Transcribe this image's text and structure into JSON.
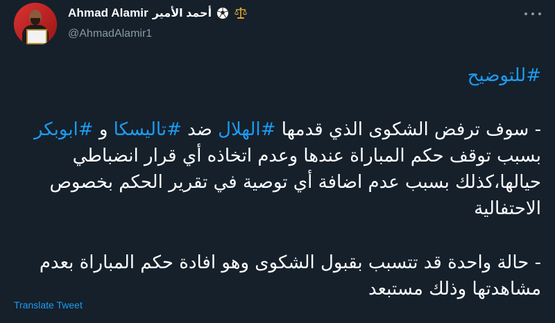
{
  "author": {
    "display_name": "Ahmad Alamir",
    "arabic_name": "أحمد الأمير",
    "handle": "@AhmadAlamir1",
    "icons": [
      "soccer-ball-icon",
      "scales-icon"
    ]
  },
  "tweet": {
    "hashtag_1": "#للتوضيح",
    "p1_pre": "- سوف ترفض الشكوى الذي قدمها ",
    "hashtag_2": "#الهلال",
    "p1_mid": " ضد ",
    "hashtag_3": "#تاليسكا",
    "p1_and": " و ",
    "hashtag_4": "#ابوبكر",
    "p1_rest": " بسبب توقف حكم المباراة عندها وعدم اتخاذه أي قرار انضباطي حيالها،كذلك بسبب عدم اضافة أي توصية في تقرير الحكم بخصوص الاحتفالية",
    "p2": "- حالة واحدة قد تتسبب بقبول الشكوى وهو افادة حكم المباراة بعدم مشاهدتها وذلك مستبعد"
  },
  "actions": {
    "translate_label": "Translate Tweet"
  },
  "colors": {
    "background": "#15202b",
    "text": "#ffffff",
    "secondary": "#8899a6",
    "accent": "#1d9bf0"
  }
}
